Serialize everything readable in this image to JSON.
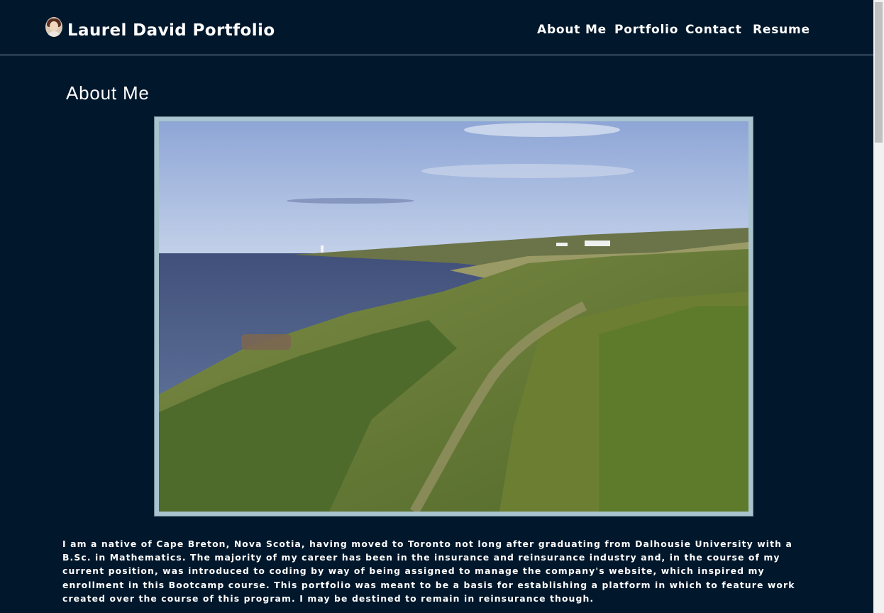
{
  "header": {
    "brand": "Laurel David Portfolio",
    "nav": [
      "About Me",
      "Portfolio",
      "Contact",
      "Resume"
    ]
  },
  "main": {
    "title": "About Me",
    "bio": "I am a native of Cape Breton, Nova Scotia, having moved to Toronto not long after graduating from Dalhousie University with a B.Sc. in Mathematics. The majority of my career has been in the insurance and reinsurance industry and, in the course of my current position, was introduced to coding by way of being assigned to manage the company's website, which inspired my enrollment in this Bootcamp course. This portfolio was meant to be a basis for establishing a platform in which to feature work created over the course of this program. I may be destined to remain in reinsurance though."
  },
  "colors": {
    "background": "#01172b",
    "frame": "#a9c4cf",
    "divider": "#8a9aa8"
  }
}
